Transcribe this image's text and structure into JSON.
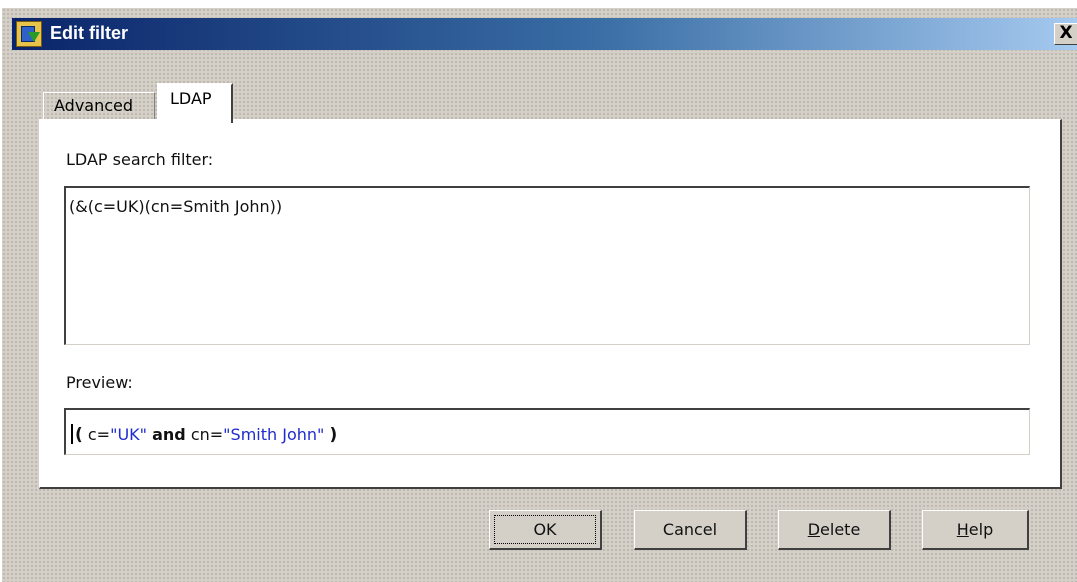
{
  "window": {
    "title": "Edit filter",
    "close_label": "X",
    "icon": "filter-app-icon"
  },
  "tabs": [
    {
      "label": "Advanced",
      "active": false
    },
    {
      "label": "LDAP",
      "active": true
    }
  ],
  "ldap": {
    "label": "LDAP search filter:",
    "value": "(&(c=UK)(cn=Smith John))"
  },
  "preview": {
    "label": "Preview:",
    "open_paren": "(",
    "attr1": "c=",
    "val1": "\"UK\"",
    "operator": "and",
    "attr2": "cn=",
    "val2": "\"Smith John\"",
    "close_paren": ")"
  },
  "buttons": {
    "ok": "OK",
    "cancel": "Cancel",
    "delete_first": "D",
    "delete_rest": "elete",
    "help_first": "H",
    "help_rest": "elp"
  },
  "colors": {
    "title_gradient_start": "#0a246a",
    "title_gradient_end": "#a6caf0",
    "value_blue": "#1f2bd0",
    "face": "#d4d0c8"
  }
}
